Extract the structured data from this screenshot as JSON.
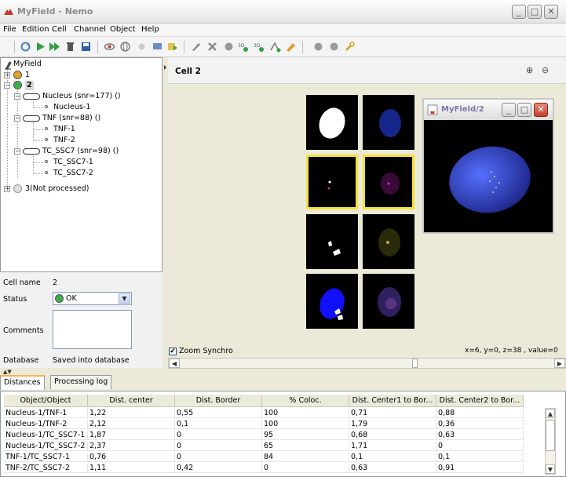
{
  "window": {
    "title": "MyField - Nemo"
  },
  "menu": [
    "File",
    "Edition",
    "Cell",
    "Channel",
    "Object",
    "Help"
  ],
  "toolbar_icons": [
    "refresh-icon",
    "play-icon",
    "fast-forward-icon",
    "trash-icon",
    "save-icon",
    "eye-icon",
    "3d-view-icon",
    "flower-icon",
    "monitor-icon",
    "export-icon",
    "pipette-icon",
    "cross-tools-icon",
    "sphere-icon",
    "3d-measure-icon",
    "3d-measure-alt-icon",
    "tree-icon",
    "annotate-icon",
    "dot-gray-icon",
    "dot-gray-2-icon",
    "wrench-icon"
  ],
  "tree": {
    "root": "MyField",
    "cells": [
      {
        "label": "1"
      },
      {
        "label": "2",
        "channels": [
          {
            "label": "Nucleus (snr=177) ()",
            "objects": [
              "Nucleus-1"
            ]
          },
          {
            "label": "TNF (snr=88) ()",
            "objects": [
              "TNF-1",
              "TNF-2"
            ]
          },
          {
            "label": "TC_SSC7 (snr=98) ()",
            "objects": [
              "TC_SSC7-1",
              "TC_SSC7-2"
            ]
          }
        ]
      },
      {
        "label": "3(Not processed)"
      }
    ]
  },
  "properties": {
    "cell_name_label": "Cell name",
    "cell_name_value": "2",
    "status_label": "Status",
    "status_value": "OK",
    "comments_label": "Comments",
    "comments_value": "",
    "database_label": "Database",
    "database_value": "Saved into database"
  },
  "viewer": {
    "title": "Cell 2",
    "zoom_sync_label": "Zoom Synchro",
    "zoom_sync_checked": true,
    "coords": "x=6, y=0, z=38 , value=0"
  },
  "popup": {
    "title": "MyField/2"
  },
  "tabs": [
    "Distances",
    "Processing log"
  ],
  "table": {
    "headers": [
      "Object/Object",
      "Dist. center",
      "Dist. Border",
      "% Coloc.",
      "Dist. Center1 to Bor...",
      "Dist. Center2 to Bor..."
    ],
    "rows": [
      [
        "Nucleus-1/TNF-1",
        "1,22",
        "0,55",
        "100",
        "0,71",
        "0,88"
      ],
      [
        "Nucleus-1/TNF-2",
        "2,12",
        "0,1",
        "100",
        "1,79",
        "0,36"
      ],
      [
        "Nucleus-1/TC_SSC7-1",
        "1,87",
        "0",
        "95",
        "0,68",
        "0,63"
      ],
      [
        "Nucleus-1/TC_SSC7-2",
        "2,37",
        "0",
        "65",
        "1,71",
        "0"
      ],
      [
        "TNF-1/TC_SSC7-1",
        "0,76",
        "0",
        "84",
        "0,1",
        "0,1"
      ],
      [
        "TNF-2/TC_SSC7-2",
        "1,11",
        "0,42",
        "0",
        "0,63",
        "0,91"
      ]
    ]
  }
}
